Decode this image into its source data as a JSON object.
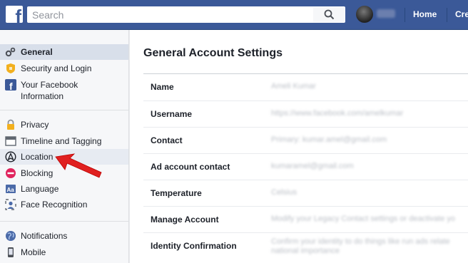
{
  "topbar": {
    "logo_letter": "f",
    "search_placeholder": "Search",
    "home_label": "Home",
    "create_label": "Cre"
  },
  "sidebar": {
    "general": "General",
    "security": "Security and Login",
    "facebook_info": "Your Facebook Information",
    "privacy": "Privacy",
    "timeline": "Timeline and Tagging",
    "location": "Location",
    "blocking": "Blocking",
    "language": "Language",
    "face_recognition": "Face Recognition",
    "notifications": "Notifications",
    "mobile": "Mobile"
  },
  "main": {
    "title": "General Account Settings",
    "rows": [
      {
        "label": "Name",
        "value": "Ameli Kumar",
        "value2": ""
      },
      {
        "label": "Username",
        "value": "https://www.facebook.com/amelkumar",
        "value2": ""
      },
      {
        "label": "Contact",
        "value": "Primary: kumar.amel@gmail.com",
        "value2": ""
      },
      {
        "label": "Ad account contact",
        "value": "kumaramel@gmail.com",
        "value2": ""
      },
      {
        "label": "Temperature",
        "value": "Celsius",
        "value2": ""
      },
      {
        "label": "Manage Account",
        "value": "Modify your Legacy Contact settings or deactivate yo",
        "value2": ""
      },
      {
        "label": "Identity Confirmation",
        "value": "Confirm your identity to do things like run ads relate",
        "value2": "national importance"
      }
    ]
  },
  "colors": {
    "brand": "#3b5998",
    "arrow": "#e02020"
  }
}
